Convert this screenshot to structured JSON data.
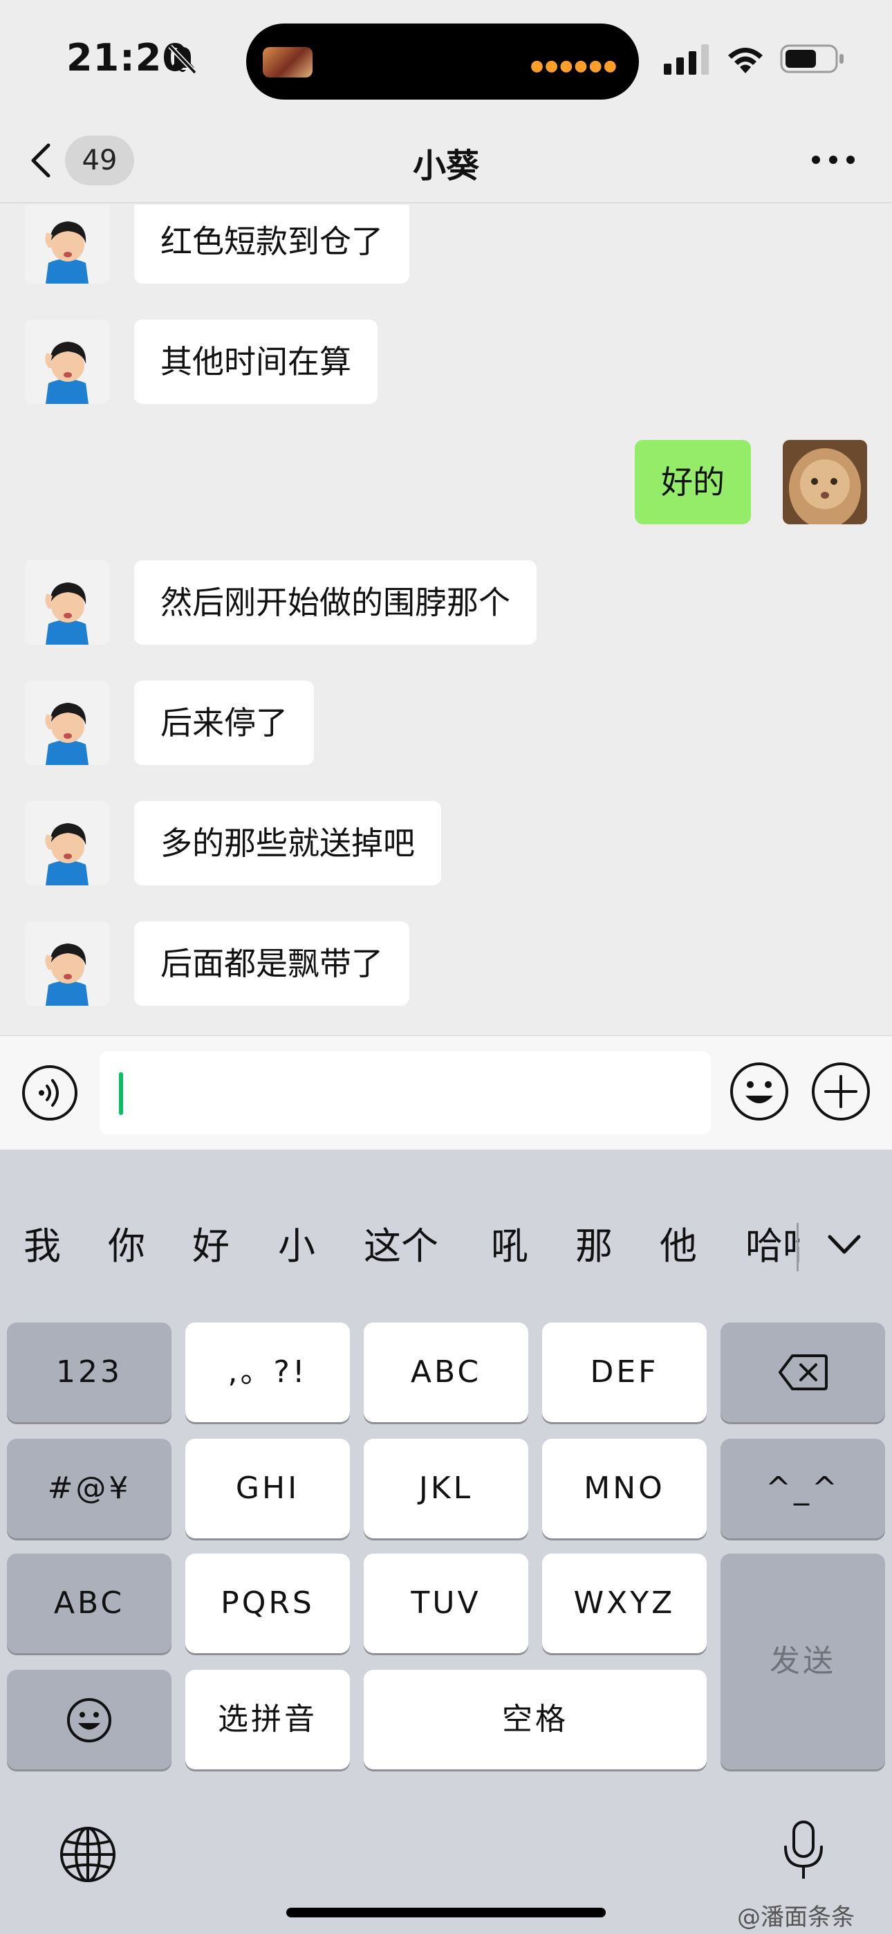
{
  "status_bar": {
    "time": "21:20"
  },
  "nav": {
    "back_badge": "49",
    "title": "小葵"
  },
  "messages": [
    {
      "side": "left",
      "text": "红色短款到仓了"
    },
    {
      "side": "left",
      "text": "其他时间在算"
    },
    {
      "side": "right",
      "text": "好的"
    },
    {
      "side": "left",
      "text": "然后刚开始做的围脖那个"
    },
    {
      "side": "left",
      "text": "后来停了"
    },
    {
      "side": "left",
      "text": "多的那些就送掉吧"
    },
    {
      "side": "left",
      "text": "后面都是飘带了"
    }
  ],
  "input": {
    "value": ""
  },
  "keyboard": {
    "candidates": [
      "我",
      "你",
      "好",
      "小",
      "这个",
      "吼",
      "那",
      "他",
      "哈哈"
    ],
    "keys": {
      "num": "123",
      "punct": ",。?!",
      "abc": "ABC",
      "def": "DEF",
      "symbols": "#@¥",
      "ghi": "GHI",
      "jkl": "JKL",
      "mno": "MNO",
      "kaomoji": "^_^",
      "abc_switch": "ABC",
      "pqrs": "PQRS",
      "tuv": "TUV",
      "wxyz": "WXYZ",
      "send": "发送",
      "pinyin": "选拼音",
      "space": "空格"
    }
  },
  "watermark": "@潘面条条",
  "colors": {
    "background": "#ededed",
    "my_bubble": "#95ec69",
    "other_bubble": "#ffffff",
    "caret": "#07c160",
    "keyboard_bg": "#d1d4db",
    "function_key": "#abb0bb"
  }
}
